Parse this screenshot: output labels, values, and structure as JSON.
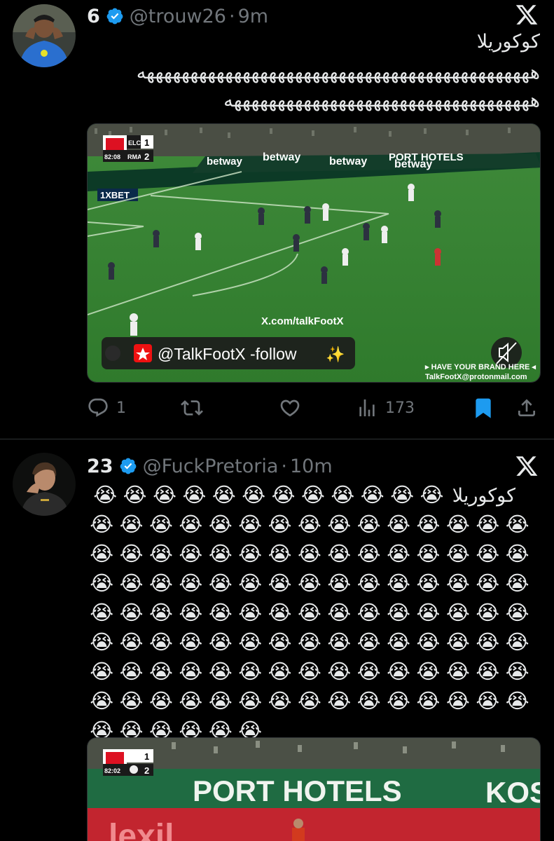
{
  "tweets": [
    {
      "name": "6",
      "handle": "@trouw26",
      "time": "9m",
      "text_line1": "كوكوريلا",
      "text_line2": "هههههههههههههههههههههههههههههههههههههههههههههه",
      "text_line3": "هههههههههههههههههههههههههههههههههههه",
      "media": {
        "score_home_team": "ELC",
        "score_away_team": "RMA",
        "score_home": "1",
        "score_away": "2",
        "clock": "82:08",
        "board_ads": [
          "betway",
          "betway",
          "betway",
          "betway"
        ],
        "url_watermark": "X.com/talkFootX",
        "follow_label": "@TalkFootX -follow",
        "brand_line1": "▸ HAVE YOUR BRAND HERE ◂",
        "brand_line2": "TalkFootX@protonmail.com",
        "ad_extra": "1XBET",
        "hotel_ad": "PORT HOTELS"
      },
      "actions": {
        "replies": "1",
        "reposts": "",
        "likes": "",
        "views": "173"
      }
    },
    {
      "name": "23",
      "handle": "@FuckPretoria",
      "time": "10m",
      "arabic": "كوكوريلا",
      "emoji": "😭",
      "emoji_first_row": 12,
      "emoji_grid_count": 111,
      "media": {
        "clock": "82:02",
        "score_home": "1",
        "score_away": "2",
        "banner": "PORT HOTELS",
        "banner_extra": "KOS",
        "lower_ad": "lexil"
      }
    }
  ],
  "colors": {
    "background": "#000000",
    "text": "#e7e9ea",
    "muted": "#71767b",
    "verified": "#1d9bf0",
    "bookmark": "#1d9bf0",
    "divider": "#2f3336"
  },
  "icons": [
    "verified-badge-icon",
    "x-logo-icon",
    "reply-icon",
    "repost-icon",
    "like-icon",
    "views-icon",
    "bookmark-icon",
    "share-icon",
    "mute-icon",
    "loudly-crying-face-emoji"
  ]
}
